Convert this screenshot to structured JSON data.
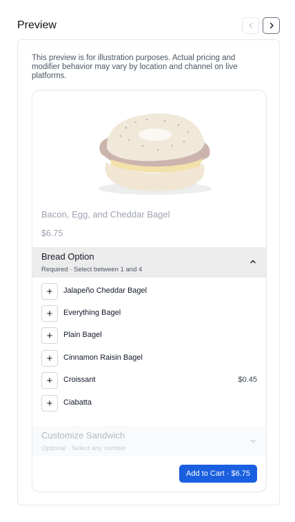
{
  "header": {
    "title": "Preview",
    "prev_icon": "chevron-left-icon",
    "next_icon": "chevron-right-icon"
  },
  "disclaimer": "This preview is for illustration purposes. Actual pricing and modifier behavior may vary by location and channel on live platforms.",
  "product": {
    "name": "Bacon, Egg, and Cheddar Bagel",
    "price": "$6.75"
  },
  "groups": [
    {
      "title": "Bread Option",
      "subtitle": "Required · Select between 1 and 4",
      "expanded": true,
      "options": [
        {
          "label": "Jalapeño Cheddar Bagel",
          "price": ""
        },
        {
          "label": "Everything Bagel",
          "price": ""
        },
        {
          "label": "Plain Bagel",
          "price": ""
        },
        {
          "label": "Cinnamon Raisin Bagel",
          "price": ""
        },
        {
          "label": "Croissant",
          "price": "$0.45"
        },
        {
          "label": "Ciabatta",
          "price": ""
        }
      ]
    },
    {
      "title": "Customize Sandwich",
      "subtitle": "Optional · Select any number",
      "expanded": false
    }
  ],
  "add_to_cart_label": "Add to Cart · $6.75",
  "colors": {
    "accent": "#1a5fe0",
    "group_active_bg": "#ececec"
  }
}
